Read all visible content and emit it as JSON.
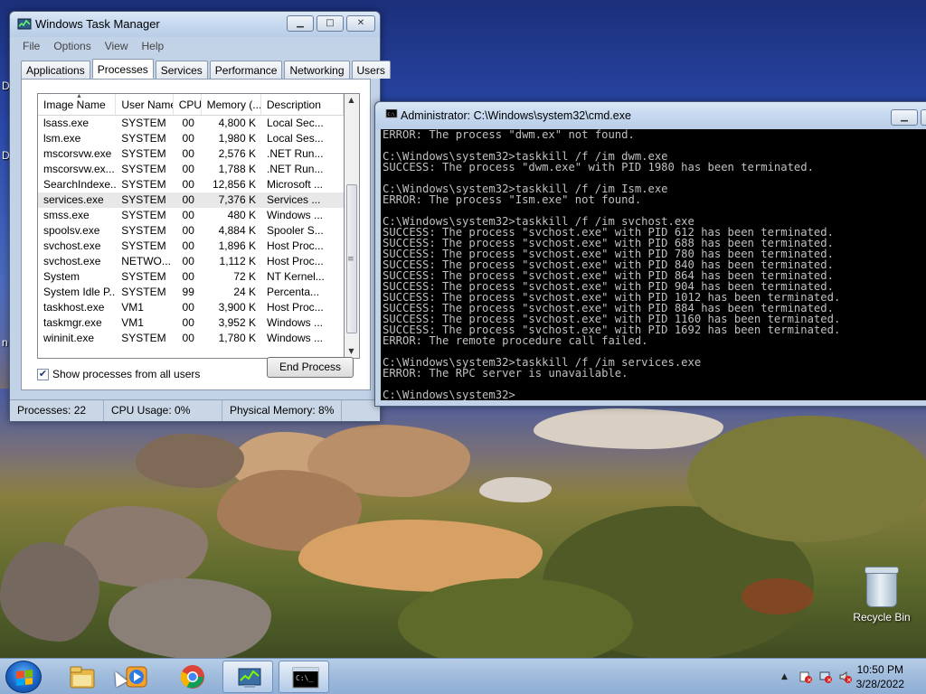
{
  "desktop": {
    "recycle_bin_label": "Recycle Bin",
    "edge_letters": [
      "D",
      "D",
      "n"
    ]
  },
  "taskmgr": {
    "title": "Windows Task Manager",
    "controls": {
      "minimize": "▁",
      "maximize": "□",
      "close": "✕"
    },
    "menu": [
      "File",
      "Options",
      "View",
      "Help"
    ],
    "tabs": [
      "Applications",
      "Processes",
      "Services",
      "Performance",
      "Networking",
      "Users"
    ],
    "active_tab": "Processes",
    "columns": [
      "Image Name",
      "User Name",
      "CPU",
      "Memory (...",
      "Description"
    ],
    "rows": [
      {
        "name": "lsass.exe",
        "user": "SYSTEM",
        "cpu": "00",
        "mem": "4,800 K",
        "desc": "Local Sec..."
      },
      {
        "name": "lsm.exe",
        "user": "SYSTEM",
        "cpu": "00",
        "mem": "1,980 K",
        "desc": "Local Ses..."
      },
      {
        "name": "mscorsvw.exe",
        "user": "SYSTEM",
        "cpu": "00",
        "mem": "2,576 K",
        "desc": ".NET Run..."
      },
      {
        "name": "mscorsvw.ex...",
        "user": "SYSTEM",
        "cpu": "00",
        "mem": "1,788 K",
        "desc": ".NET Run..."
      },
      {
        "name": "SearchIndexe...",
        "user": "SYSTEM",
        "cpu": "00",
        "mem": "12,856 K",
        "desc": "Microsoft ..."
      },
      {
        "name": "services.exe",
        "user": "SYSTEM",
        "cpu": "00",
        "mem": "7,376 K",
        "desc": "Services ..."
      },
      {
        "name": "smss.exe",
        "user": "SYSTEM",
        "cpu": "00",
        "mem": "480 K",
        "desc": "Windows ..."
      },
      {
        "name": "spoolsv.exe",
        "user": "SYSTEM",
        "cpu": "00",
        "mem": "4,884 K",
        "desc": "Spooler S..."
      },
      {
        "name": "svchost.exe",
        "user": "SYSTEM",
        "cpu": "00",
        "mem": "1,896 K",
        "desc": "Host Proc..."
      },
      {
        "name": "svchost.exe",
        "user": "NETWO...",
        "cpu": "00",
        "mem": "1,112 K",
        "desc": "Host Proc..."
      },
      {
        "name": "System",
        "user": "SYSTEM",
        "cpu": "00",
        "mem": "72 K",
        "desc": "NT Kernel..."
      },
      {
        "name": "System Idle P...",
        "user": "SYSTEM",
        "cpu": "99",
        "mem": "24 K",
        "desc": "Percenta..."
      },
      {
        "name": "taskhost.exe",
        "user": "VM1",
        "cpu": "00",
        "mem": "3,900 K",
        "desc": "Host Proc..."
      },
      {
        "name": "taskmgr.exe",
        "user": "VM1",
        "cpu": "00",
        "mem": "3,952 K",
        "desc": "Windows ..."
      },
      {
        "name": "wininit.exe",
        "user": "SYSTEM",
        "cpu": "00",
        "mem": "1,780 K",
        "desc": "Windows ..."
      }
    ],
    "selected_row": "services.exe",
    "show_all_label": "Show processes from all users",
    "show_all_checked": true,
    "end_process_label": "End Process",
    "status": {
      "processes": "Processes: 22",
      "cpu": "CPU Usage: 0%",
      "memory": "Physical Memory: 8%"
    }
  },
  "cmd": {
    "title": "Administrator: C:\\Windows\\system32\\cmd.exe",
    "lines": [
      "ERROR: The process \"dwm.ex\" not found.",
      "",
      "C:\\Windows\\system32>taskkill /f /im dwm.exe",
      "SUCCESS: The process \"dwm.exe\" with PID 1980 has been terminated.",
      "",
      "C:\\Windows\\system32>taskkill /f /im Ism.exe",
      "ERROR: The process \"Ism.exe\" not found.",
      "",
      "C:\\Windows\\system32>taskkill /f /im svchost.exe",
      "SUCCESS: The process \"svchost.exe\" with PID 612 has been terminated.",
      "SUCCESS: The process \"svchost.exe\" with PID 688 has been terminated.",
      "SUCCESS: The process \"svchost.exe\" with PID 780 has been terminated.",
      "SUCCESS: The process \"svchost.exe\" with PID 840 has been terminated.",
      "SUCCESS: The process \"svchost.exe\" with PID 864 has been terminated.",
      "SUCCESS: The process \"svchost.exe\" with PID 904 has been terminated.",
      "SUCCESS: The process \"svchost.exe\" with PID 1012 has been terminated.",
      "SUCCESS: The process \"svchost.exe\" with PID 884 has been terminated.",
      "SUCCESS: The process \"svchost.exe\" with PID 1160 has been terminated.",
      "SUCCESS: The process \"svchost.exe\" with PID 1692 has been terminated.",
      "ERROR: The remote procedure call failed.",
      "",
      "C:\\Windows\\system32>taskkill /f /im services.exe",
      "ERROR: The RPC server is unavailable.",
      "",
      "C:\\Windows\\system32>"
    ]
  },
  "taskbar": {
    "pinned": [
      "start-orb",
      "windows-explorer-icon",
      "media-player-icon",
      "chrome-icon",
      "task-manager-icon",
      "cmd-icon"
    ],
    "clock_time": "10:50 PM",
    "clock_date": "3/28/2022"
  },
  "colors": {
    "console_bg": "#000000",
    "console_fg": "#c0c0c0",
    "window_frame": "#c2d3e8",
    "taskbar": "#9fbbdc"
  }
}
